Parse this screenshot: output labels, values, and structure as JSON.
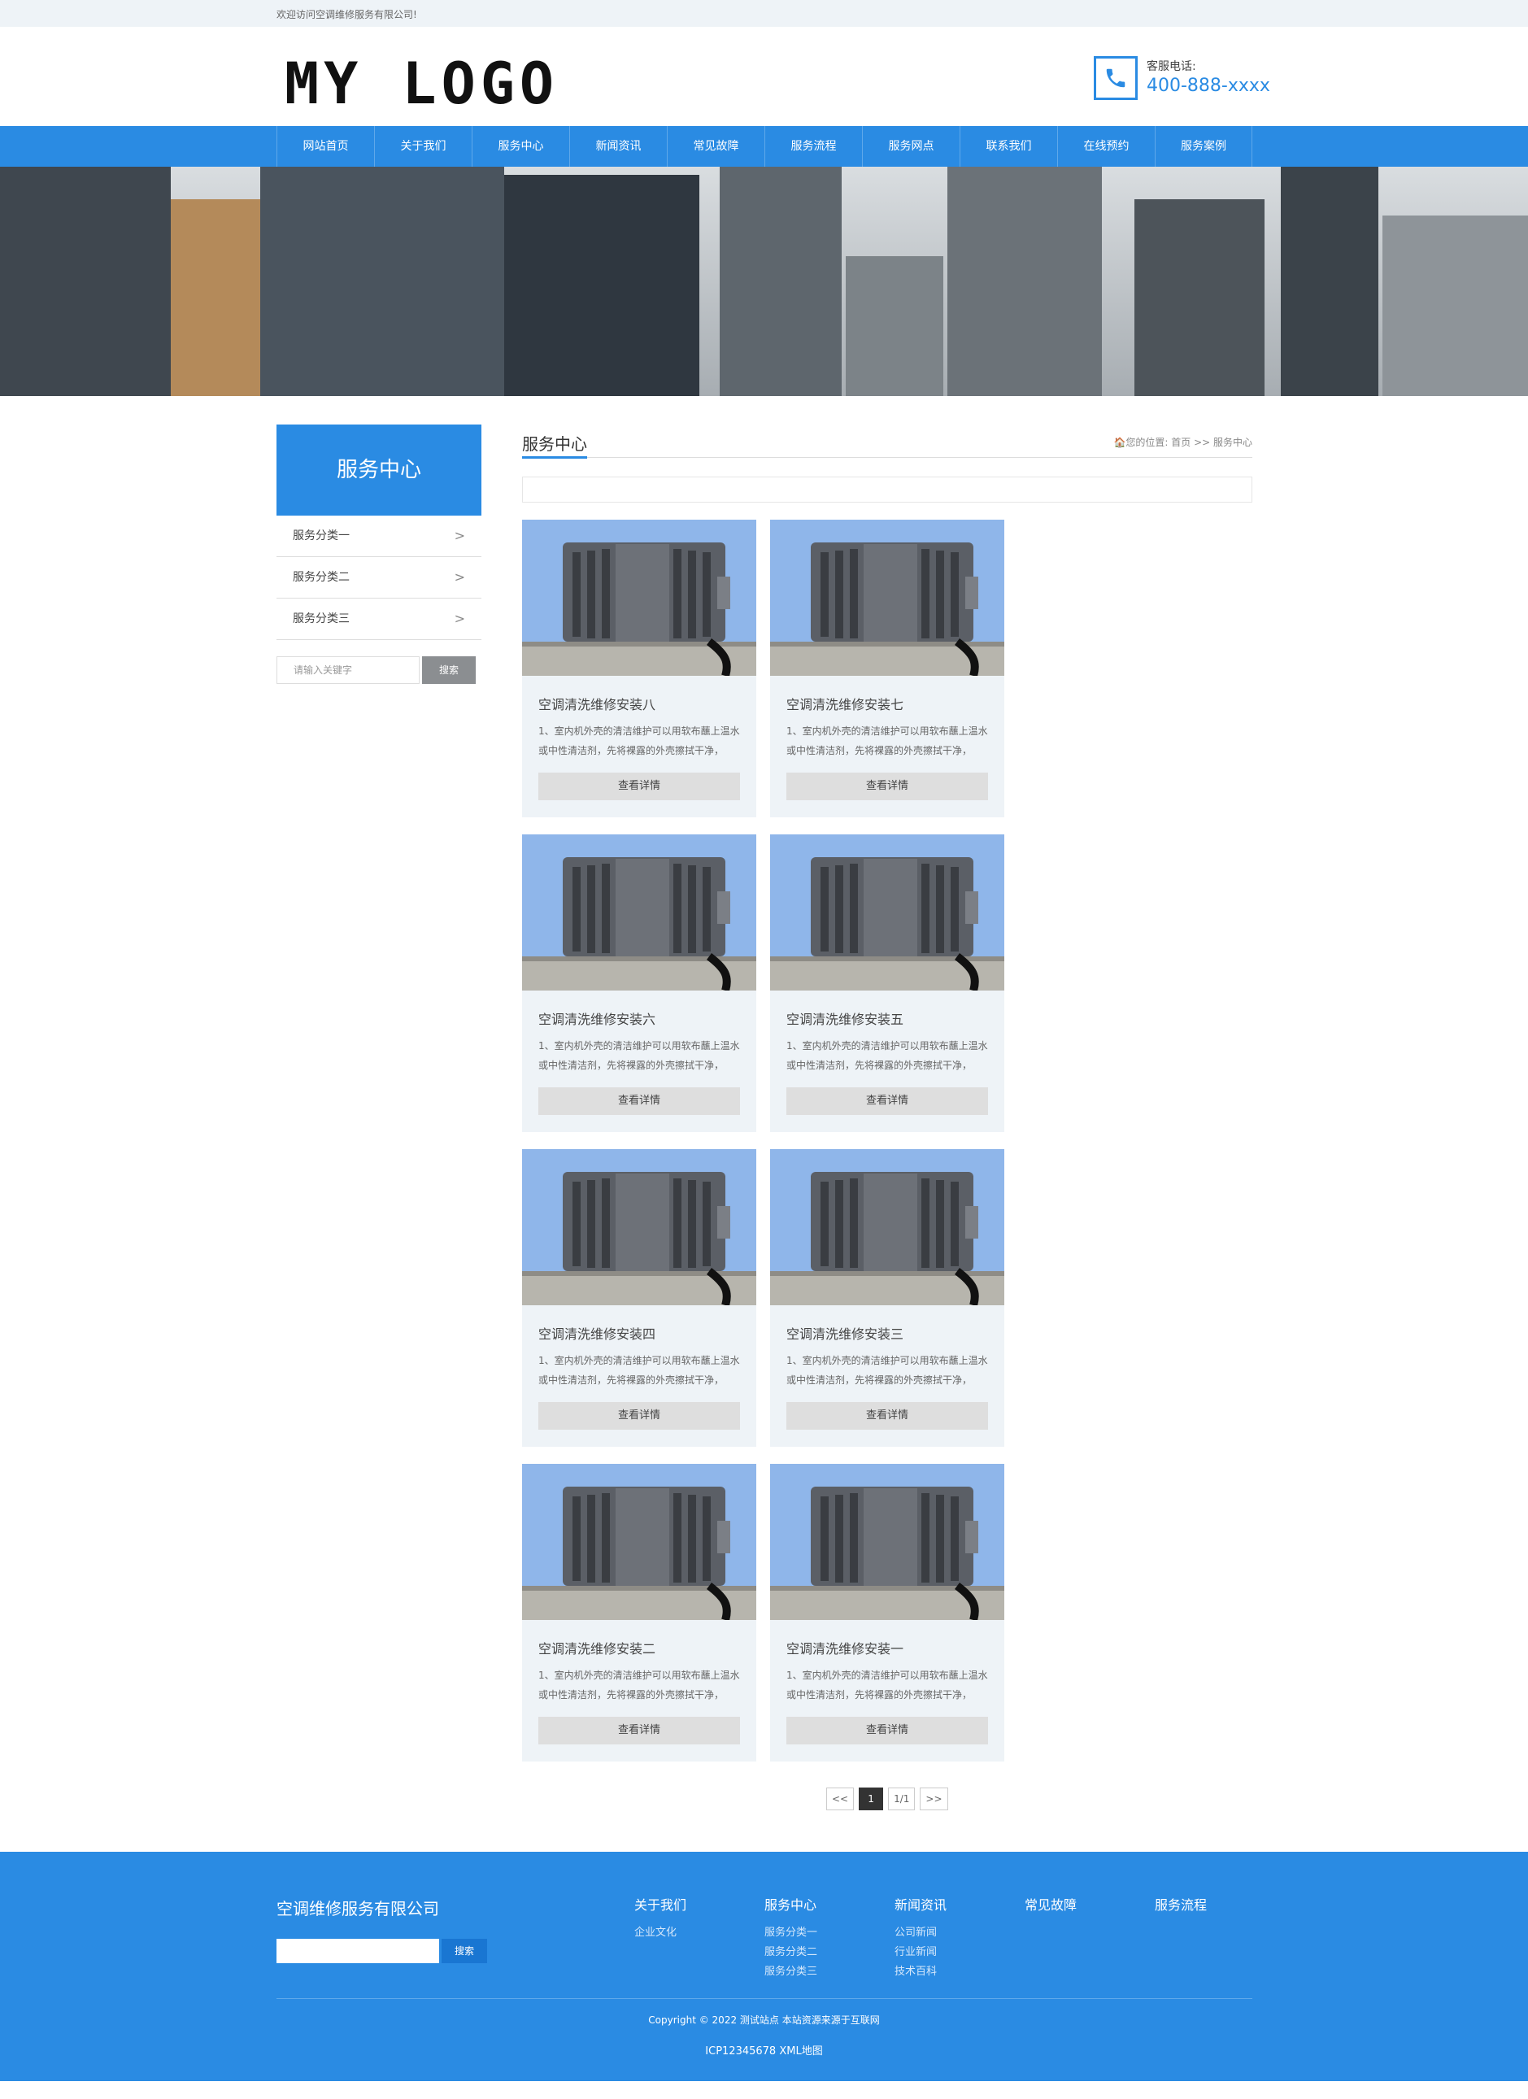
{
  "topbar": {
    "welcome": "欢迎访问空调维修服务有限公司!"
  },
  "header": {
    "logo_text": "MY LOGO",
    "phone_label": "客服电话:",
    "phone_number": "400-888-xxxx",
    "phone_icon": "phone-icon"
  },
  "nav": {
    "items": [
      "网站首页",
      "关于我们",
      "服务中心",
      "新闻资讯",
      "常见故障",
      "服务流程",
      "服务网点",
      "联系我们",
      "在线预约",
      "服务案例"
    ]
  },
  "sidebar": {
    "title": "服务中心",
    "items": [
      "服务分类一",
      "服务分类二",
      "服务分类三"
    ],
    "chevron": ">",
    "search_placeholder": "请输入关键字",
    "search_button": "搜索"
  },
  "main": {
    "title": "服务中心",
    "breadcrumb": "🏠您的位置: 首页 >> 服务中心",
    "cards": [
      {
        "title": "空调清洗维修安装八",
        "desc": "1、室内机外壳的清洁维护可以用软布蘸上温水或中性清洁剂，先将裸露的外壳擦拭干净，然...",
        "button": "查看详情"
      },
      {
        "title": "空调清洗维修安装七",
        "desc": "1、室内机外壳的清洁维护可以用软布蘸上温水或中性清洁剂，先将裸露的外壳擦拭干净，然...",
        "button": "查看详情"
      },
      {
        "title": "空调清洗维修安装六",
        "desc": "1、室内机外壳的清洁维护可以用软布蘸上温水或中性清洁剂，先将裸露的外壳擦拭干净，然...",
        "button": "查看详情"
      },
      {
        "title": "空调清洗维修安装五",
        "desc": "1、室内机外壳的清洁维护可以用软布蘸上温水或中性清洁剂，先将裸露的外壳擦拭干净，然...",
        "button": "查看详情"
      },
      {
        "title": "空调清洗维修安装四",
        "desc": "1、室内机外壳的清洁维护可以用软布蘸上温水或中性清洁剂，先将裸露的外壳擦拭干净，然...",
        "button": "查看详情"
      },
      {
        "title": "空调清洗维修安装三",
        "desc": "1、室内机外壳的清洁维护可以用软布蘸上温水或中性清洁剂，先将裸露的外壳擦拭干净，然...",
        "button": "查看详情"
      },
      {
        "title": "空调清洗维修安装二",
        "desc": "1、室内机外壳的清洁维护可以用软布蘸上温水或中性清洁剂，先将裸露的外壳擦拭干净，然...",
        "button": "查看详情"
      },
      {
        "title": "空调清洗维修安装一",
        "desc": "1、室内机外壳的清洁维护可以用软布蘸上温水或中性清洁剂，先将裸露的外壳擦拭干净，然...",
        "button": "查看详情"
      }
    ]
  },
  "pagination": {
    "prev": "<<",
    "current": "1",
    "summary": "1/1",
    "next": ">>"
  },
  "footer": {
    "company": "空调维修服务有限公司",
    "search_button": "搜索",
    "columns": [
      {
        "title": "关于我们",
        "links": [
          "企业文化"
        ]
      },
      {
        "title": "服务中心",
        "links": [
          "服务分类一",
          "服务分类二",
          "服务分类三"
        ]
      },
      {
        "title": "新闻资讯",
        "links": [
          "公司新闻",
          "行业新闻",
          "技术百科"
        ]
      },
      {
        "title": "常见故障",
        "links": []
      },
      {
        "title": "服务流程",
        "links": []
      }
    ],
    "copyright": "Copyright © 2022 测试站点 本站资源来源于互联网",
    "icp": "ICP12345678 XML地图"
  },
  "colors": {
    "brand_blue": "#2a8be3",
    "card_bg": "#eef3f7",
    "button_gray": "#dedede"
  }
}
